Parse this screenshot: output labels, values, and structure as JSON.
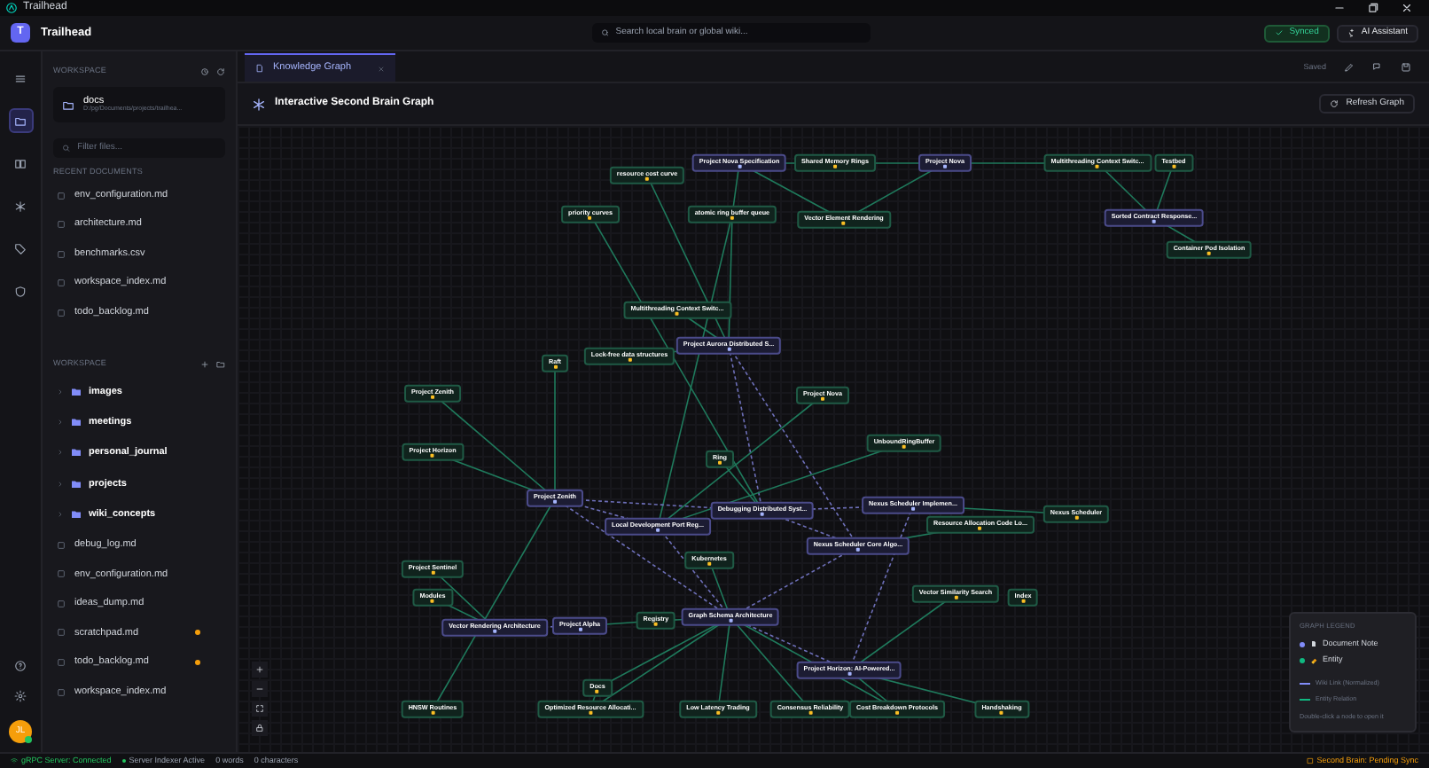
{
  "window": {
    "title": "Trailhead"
  },
  "header": {
    "app_name": "Trailhead",
    "logo_letter": "T",
    "search": {
      "placeholder": "Search local brain or global wiki..."
    },
    "sync_badge": "Synced",
    "assistant_button": "AI Assistant"
  },
  "rail": {
    "items": [
      {
        "kind": "menu",
        "selected": false
      },
      {
        "kind": "files",
        "selected": true
      },
      {
        "kind": "book",
        "selected": false
      },
      {
        "kind": "graph",
        "selected": false
      },
      {
        "kind": "tags",
        "selected": false
      },
      {
        "kind": "shield",
        "selected": false
      }
    ],
    "avatar": "JL",
    "online": true
  },
  "sidebar": {
    "workspace_label": "WORKSPACE",
    "root": {
      "name": "docs",
      "path": "D:/pg/Documents/projects/trailhea..."
    },
    "filter": {
      "placeholder": "Filter files..."
    },
    "recent_label": "RECENT DOCUMENTS",
    "recent": [
      "env_configuration.md",
      "architecture.md",
      "benchmarks.csv",
      "workspace_index.md",
      "todo_backlog.md"
    ],
    "tree_label": "WORKSPACE",
    "tree": [
      {
        "name": "images",
        "kind": "folder"
      },
      {
        "name": "meetings",
        "kind": "folder"
      },
      {
        "name": "personal_journal",
        "kind": "folder"
      },
      {
        "name": "projects",
        "kind": "folder"
      },
      {
        "name": "wiki_concepts",
        "kind": "folder"
      },
      {
        "name": "debug_log.md",
        "kind": "file",
        "modified": false
      },
      {
        "name": "env_configuration.md",
        "kind": "file",
        "modified": false
      },
      {
        "name": "ideas_dump.md",
        "kind": "file",
        "modified": false
      },
      {
        "name": "scratchpad.md",
        "kind": "file",
        "modified": true
      },
      {
        "name": "todo_backlog.md",
        "kind": "file",
        "modified": true
      },
      {
        "name": "workspace_index.md",
        "kind": "file",
        "modified": false
      }
    ]
  },
  "tabs": [
    {
      "label": "Knowledge Graph",
      "selected": true
    }
  ],
  "save_state": "Saved",
  "graph": {
    "title": "Interactive Second Brain Graph",
    "refresh_button": "Refresh Graph",
    "nodes": [
      {
        "label": "Project Nova Specification",
        "kind": "document"
      },
      {
        "label": "Shared Memory Rings",
        "kind": "entity"
      },
      {
        "label": "Project Nova",
        "kind": "document"
      },
      {
        "label": "Multithreading Context Switc...",
        "kind": "entity"
      },
      {
        "label": "Testbed",
        "kind": "entity"
      },
      {
        "label": "resource cost curve",
        "kind": "entity"
      },
      {
        "label": "priority curves",
        "kind": "entity"
      },
      {
        "label": "atomic ring buffer queue",
        "kind": "entity"
      },
      {
        "label": "Vector Element Rendering",
        "kind": "entity"
      },
      {
        "label": "Sorted Contract Response...",
        "kind": "document"
      },
      {
        "label": "Container Pod Isolation",
        "kind": "entity"
      },
      {
        "label": "Multithreading Context Switc...",
        "kind": "entity"
      },
      {
        "label": "Project Aurora Distributed S...",
        "kind": "document"
      },
      {
        "label": "Lock-free data structures",
        "kind": "entity"
      },
      {
        "label": "Raft",
        "kind": "entity"
      },
      {
        "label": "Project Zenith",
        "kind": "entity"
      },
      {
        "label": "Project Nova",
        "kind": "entity"
      },
      {
        "label": "Project Horizon",
        "kind": "entity"
      },
      {
        "label": "Ring",
        "kind": "entity"
      },
      {
        "label": "UnboundRingBuffer",
        "kind": "entity"
      },
      {
        "label": "Project Zenith",
        "kind": "document"
      },
      {
        "label": "Debugging Distributed Syst...",
        "kind": "document"
      },
      {
        "label": "Nexus Scheduler Implemen...",
        "kind": "document"
      },
      {
        "label": "Resource Allocation Code Lo...",
        "kind": "entity"
      },
      {
        "label": "Nexus Scheduler",
        "kind": "entity"
      },
      {
        "label": "Local Development Port Reg...",
        "kind": "document"
      },
      {
        "label": "Nexus Scheduler Core Algo...",
        "kind": "document"
      },
      {
        "label": "Kubernetes",
        "kind": "entity"
      },
      {
        "label": "Project Sentinel",
        "kind": "entity"
      },
      {
        "label": "Modules",
        "kind": "entity"
      },
      {
        "label": "Vector Rendering Architecture",
        "kind": "document"
      },
      {
        "label": "Project Alpha",
        "kind": "document"
      },
      {
        "label": "Registry",
        "kind": "entity"
      },
      {
        "label": "Graph Schema Architecture",
        "kind": "document"
      },
      {
        "label": "Vector Similarity Search",
        "kind": "entity"
      },
      {
        "label": "Index",
        "kind": "entity"
      },
      {
        "label": "Project Horizon: AI-Powered...",
        "kind": "document"
      },
      {
        "label": "Docs",
        "kind": "entity"
      },
      {
        "label": "HNSW Routines",
        "kind": "entity"
      },
      {
        "label": "Optimized Resource Allocati...",
        "kind": "entity"
      },
      {
        "label": "Low Latency Trading",
        "kind": "entity"
      },
      {
        "label": "Consensus Reliability",
        "kind": "entity"
      },
      {
        "label": "Cost Breakdown Protocols",
        "kind": "entity"
      },
      {
        "label": "Handshaking",
        "kind": "entity"
      }
    ],
    "legend": {
      "title": "GRAPH LEGEND",
      "items": [
        {
          "label": "Document Note",
          "kind": "document"
        },
        {
          "label": "Entity",
          "kind": "entity"
        }
      ],
      "links": [
        {
          "label": "Wiki Link (Normalized)",
          "kind": "wiki"
        },
        {
          "label": "Entity Relation",
          "kind": "relation"
        }
      ],
      "hint": "Double-click a node to open it"
    }
  },
  "status_bar": {
    "grpc": "gRPC Server: Connected",
    "indexer": "Server Indexer Active",
    "words": "0 words",
    "characters": "0 characters",
    "sync": "Second Brain: Pending Sync"
  }
}
